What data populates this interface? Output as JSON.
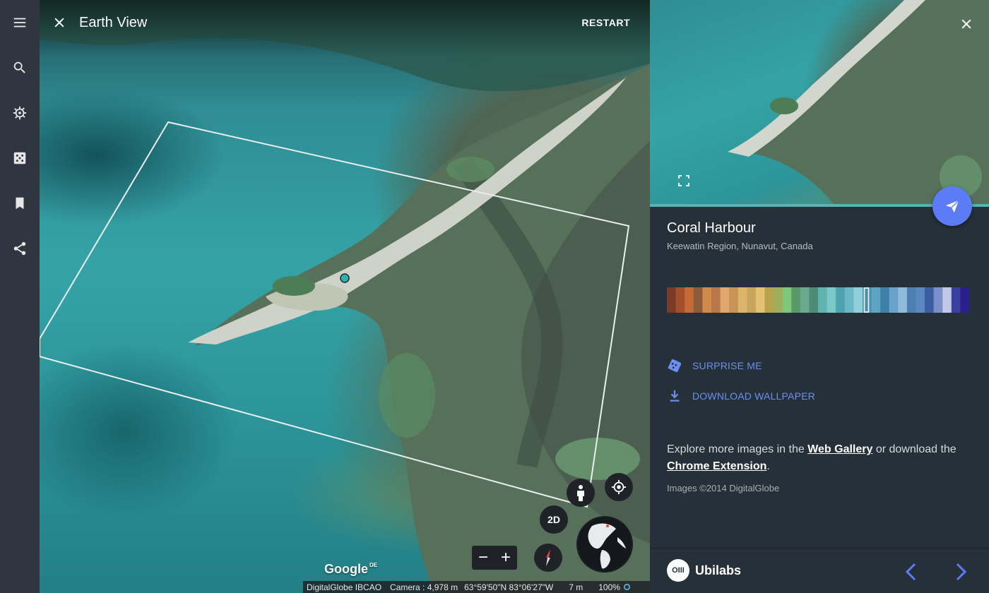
{
  "app": {
    "title": "Earth View",
    "restart_label": "RESTART"
  },
  "rail": {
    "icons": [
      "menu-icon",
      "search-icon",
      "voyager-icon",
      "random-dice-icon",
      "bookmark-icon",
      "share-icon"
    ]
  },
  "map_controls": {
    "pegman": "pegman-icon",
    "locate": "my-location-icon",
    "view_mode_label": "2D",
    "zoom_out_label": "−",
    "zoom_in_label": "+",
    "compass": "compass-icon"
  },
  "attribution": {
    "logo": "Google",
    "logo_sup": "DE",
    "imagery": "DigitalGlobe IBCAO",
    "camera": "Camera :  4,978 m",
    "coords": "63°59'50\"N 83°06'27\"W",
    "scale": "7 m",
    "zoom": "100%"
  },
  "panel": {
    "place_name": "Coral Harbour",
    "place_region": "Keewatin Region, Nunavut, Canada",
    "surprise_label": "SURPRISE ME",
    "download_label": "DOWNLOAD WALLPAPER",
    "explore_prefix": "Explore more images in the ",
    "web_gallery_label": "Web Gallery",
    "explore_middle": " or download the ",
    "chrome_ext_label": "Chrome Extension",
    "explore_suffix": ".",
    "copyright": "Images ©2014 DigitalGlobe",
    "brand": "Ubilabs",
    "brand_logo_text": "OIII"
  },
  "palette": {
    "selected_fraction": 0.66,
    "colors": [
      "#7a3a2a",
      "#a54f2a",
      "#c36a36",
      "#8d5a3b",
      "#d08b4a",
      "#b9784a",
      "#e0a86a",
      "#c99256",
      "#dcb46c",
      "#caa35c",
      "#e2c270",
      "#b7a24e",
      "#9fae5a",
      "#7ec77a",
      "#5a9a6a",
      "#6aa98c",
      "#4d8a7a",
      "#5fb3b0",
      "#7cc8c8",
      "#4fa2b0",
      "#6bb7c8",
      "#8fd0dc",
      "#4a93b0",
      "#5da4c2",
      "#3f7fa8",
      "#6aa3c9",
      "#8fbcd8",
      "#4c7fb0",
      "#5b88bf",
      "#3b5ea3",
      "#7d8fc9",
      "#c0c8e6",
      "#3a3fa0",
      "#2a1f8c"
    ],
    "accent_color": "#5b7cf5",
    "link_color": "#6d8ef2"
  }
}
